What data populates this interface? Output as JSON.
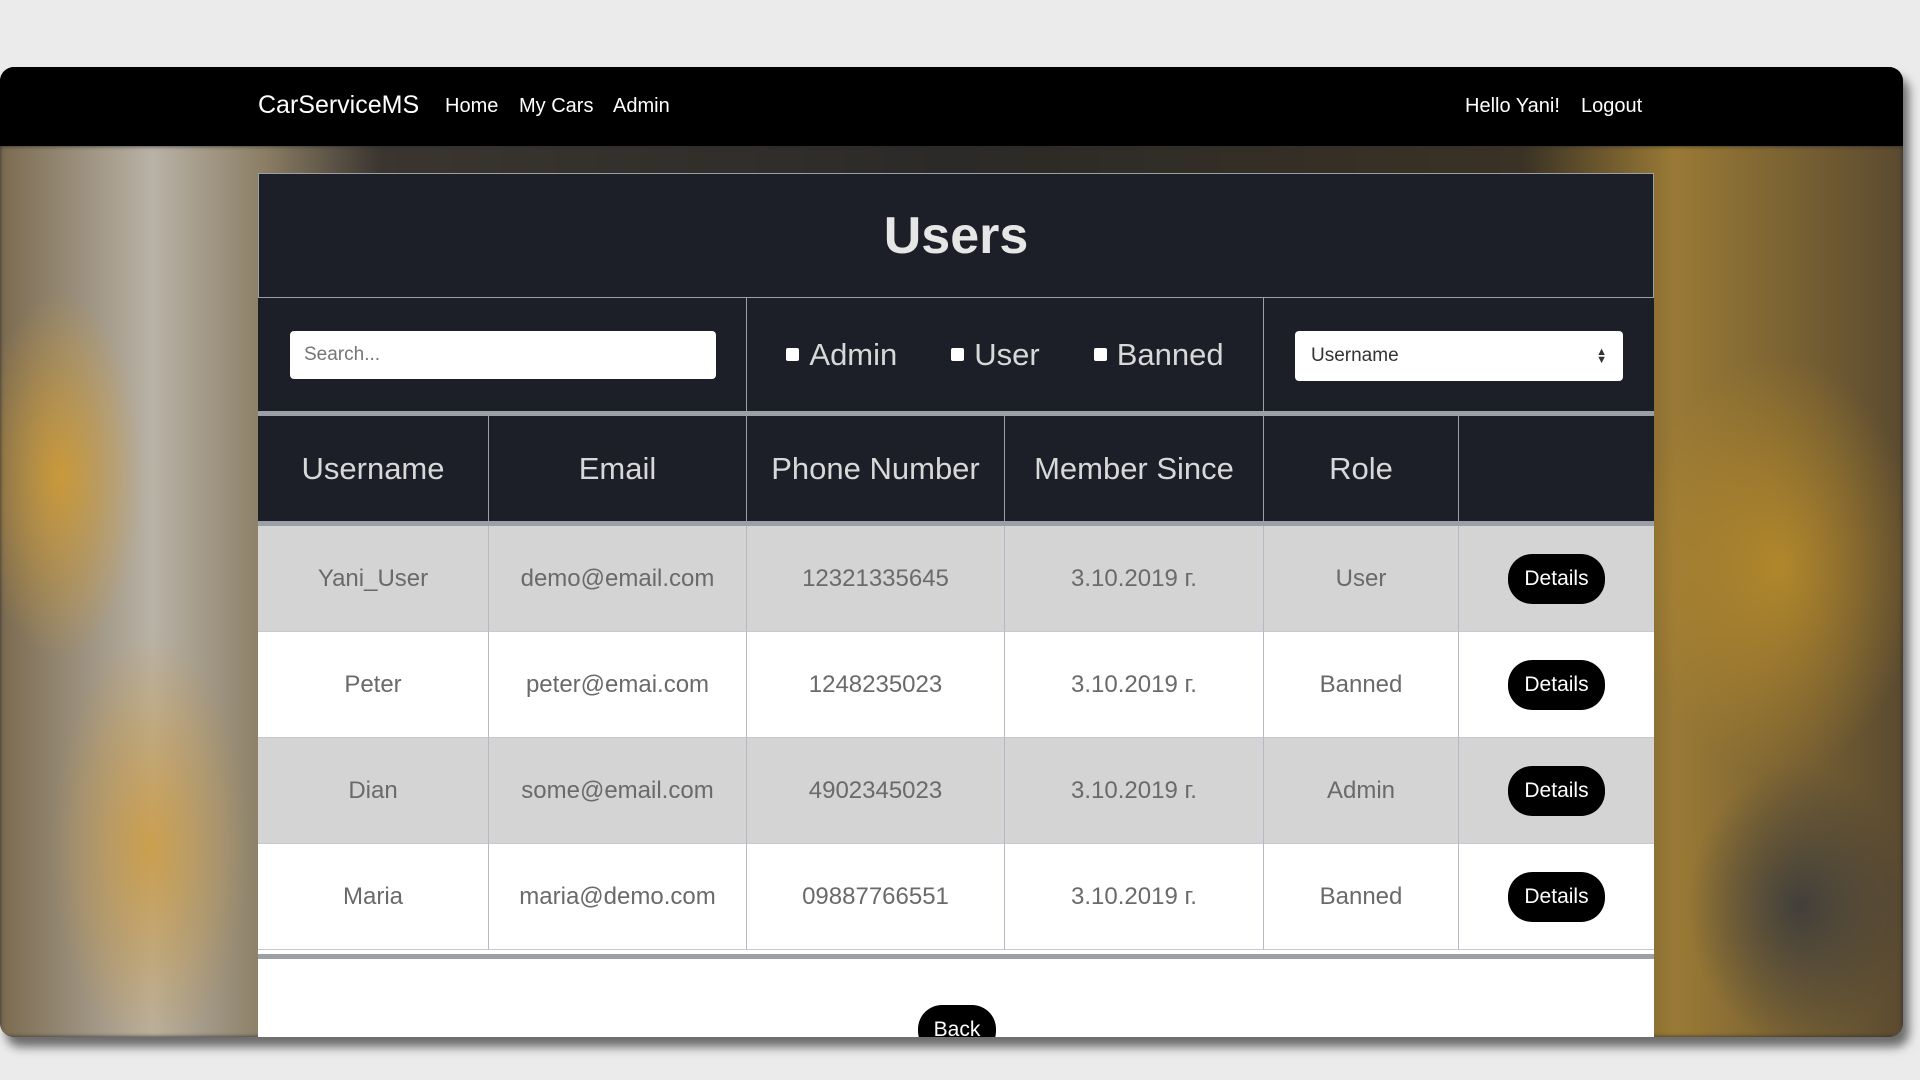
{
  "navbar": {
    "brand": "CarServiceMS",
    "links": [
      "Home",
      "My Cars",
      "Admin"
    ],
    "greeting": "Hello Yani!",
    "logout": "Logout"
  },
  "panel": {
    "title": "Users"
  },
  "filters": {
    "search_placeholder": "Search...",
    "checkboxes": [
      "Admin",
      "User",
      "Banned"
    ],
    "sort_selected": "Username"
  },
  "table": {
    "columns": [
      "Username",
      "Email",
      "Phone Number",
      "Member Since",
      "Role",
      ""
    ],
    "rows": [
      {
        "username": "Yani_User",
        "email": "demo@email.com",
        "phone": "12321335645",
        "since": "3.10.2019 г.",
        "role": "User",
        "action": "Details"
      },
      {
        "username": "Peter",
        "email": "peter@emai.com",
        "phone": "1248235023",
        "since": "3.10.2019 г.",
        "role": "Banned",
        "action": "Details"
      },
      {
        "username": "Dian",
        "email": "some@email.com",
        "phone": "4902345023",
        "since": "3.10.2019 г.",
        "role": "Admin",
        "action": "Details"
      },
      {
        "username": "Maria",
        "email": "maria@demo.com",
        "phone": "09887766551",
        "since": "3.10.2019 г.",
        "role": "Banned",
        "action": "Details"
      }
    ]
  },
  "back_label": "Back"
}
